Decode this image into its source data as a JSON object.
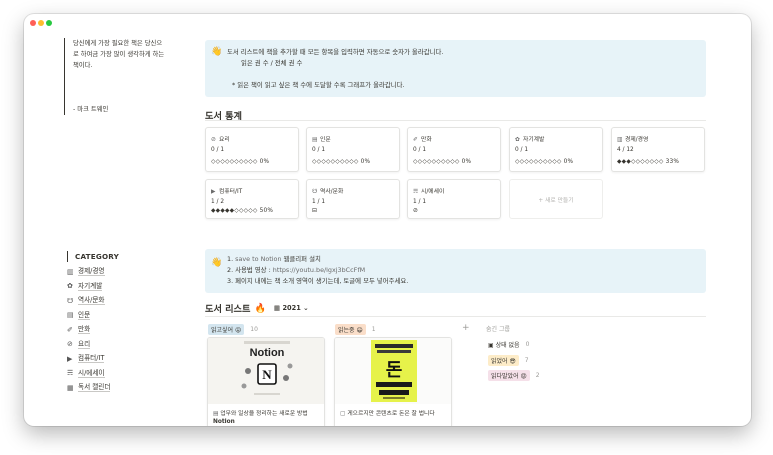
{
  "window": {
    "controls": [
      "close",
      "minimize",
      "zoom"
    ]
  },
  "quote": {
    "lines": [
      "당신에게 가장 필요한 책은 당신으",
      "로 하여금 가장 많이 생각하게 하는",
      "책이다."
    ],
    "author": "- 마크 트웨인"
  },
  "callout1": {
    "emoji": "👋",
    "line1": "도서 리스트에 책을 추가할 때 모든 항목을 입력하면 자동으로 숫자가 올라갑니다.",
    "line2": "읽은 권 수 / 전체 권 수",
    "line3": "* 읽은 책이 읽고 싶은 책 수에 도달할 수록 그래프가 올라갑니다."
  },
  "stats": {
    "title": "도서 통계",
    "cards": [
      {
        "icon": "⊘",
        "icon_name": "cooking-icon",
        "label": "요리",
        "count": "0 / 1",
        "bar": "◇◇◇◇◇◇◇◇◇◇ 0%",
        "fraction": 0.0
      },
      {
        "icon": "▤",
        "icon_name": "column-icon",
        "label": "인문",
        "count": "0 / 1",
        "bar": "◇◇◇◇◇◇◇◇◇◇ 0%",
        "fraction": 0.0
      },
      {
        "icon": "✐",
        "icon_name": "pen-icon",
        "label": "만화",
        "count": "0 / 1",
        "bar": "◇◇◇◇◇◇◇◇◇◇ 0%",
        "fraction": 0.0
      },
      {
        "icon": "✿",
        "icon_name": "brain-icon",
        "label": "자기계발",
        "count": "0 / 1",
        "bar": "◇◇◇◇◇◇◇◇◇◇ 0%",
        "fraction": 0.0
      },
      {
        "icon": "▥",
        "icon_name": "chart-icon",
        "label": "경제/경영",
        "count": "4 / 12",
        "bar": "◆◆◆◇◇◇◇◇◇◇ 33%",
        "fraction": 0.33
      },
      {
        "icon": "▶",
        "icon_name": "computer-icon",
        "label": "컴퓨터/IT",
        "count": "1 / 2",
        "bar": "◆◆◆◆◆◇◇◇◇◇ 50%",
        "fraction": 0.5
      },
      {
        "icon": "☋",
        "icon_name": "history-icon",
        "label": "역사/문화",
        "count": "1 / 1",
        "bar": "⊟",
        "fraction": 1.0
      },
      {
        "icon": "☴",
        "icon_name": "poetry-icon",
        "label": "시/에세이",
        "count": "1 / 1",
        "bar": "⊘",
        "fraction": 1.0
      }
    ],
    "new_label": "+ 새로 만들기"
  },
  "sidebar": {
    "heading": "CATEGORY",
    "items": [
      {
        "icon": "▥",
        "icon_name": "chart-icon",
        "label": "경제/경영"
      },
      {
        "icon": "✿",
        "icon_name": "brain-icon",
        "label": "자기계발"
      },
      {
        "icon": "☋",
        "icon_name": "history-icon",
        "label": "역사/문화"
      },
      {
        "icon": "▤",
        "icon_name": "column-icon",
        "label": "인문"
      },
      {
        "icon": "✐",
        "icon_name": "pen-icon",
        "label": "만화"
      },
      {
        "icon": "⊘",
        "icon_name": "cooking-icon",
        "label": "요리"
      },
      {
        "icon": "▶",
        "icon_name": "computer-icon",
        "label": "컴퓨터/IT"
      },
      {
        "icon": "☴",
        "icon_name": "poetry-icon",
        "label": "시/에세이"
      },
      {
        "icon": "▦",
        "icon_name": "calendar-icon",
        "label": "독서 캘린더"
      }
    ]
  },
  "callout2": {
    "emoji": "👋",
    "line1_pre": "1. ",
    "line1_link": "save to Notion",
    "line1_post": " 웹클리퍼 설치",
    "line2_pre": "2. 사용법 영상 : ",
    "line2_link": "https://youtu.be/lgxj3bCcFfM",
    "line3": "3. 페이지 내에는 책 소개 영역이 생기는데, 토글에 모두 넣어주세요."
  },
  "database": {
    "title": "도서 리스트",
    "title_emoji": "🔥",
    "view_icon": "▦",
    "view_label": "2021",
    "columns": [
      {
        "tag": "읽고싶어 😝",
        "count": "10",
        "card": {
          "icon": "▤",
          "cover_title": "Notion",
          "caption": "업무와 일상을 정리하는 새로운 방법",
          "caption2": "Notion"
        }
      },
      {
        "tag": "읽는중 😄",
        "count": "1",
        "card": {
          "icon": "▢",
          "cover_title": "돈",
          "caption": "게으르지만 콘텐츠로 돈은 잘 법니다",
          "caption2": ""
        }
      }
    ],
    "add_symbol": "+",
    "hidden_title": "숨긴 그룹",
    "hidden": [
      {
        "icon": "▣",
        "label": "상태 없음",
        "count": "0"
      },
      {
        "label": "읽었어 😎",
        "count": "7"
      },
      {
        "label": "읽다말았어 😡",
        "count": "2"
      }
    ]
  },
  "colors": {
    "callout_bg": "#e7f3f8",
    "close": "#ff5f57",
    "minimize": "#febc2e",
    "zoom": "#28c840",
    "tag_blue": "#d3e5ef",
    "tag_orange": "#fadec9",
    "tag_yellow": "#fdecc8",
    "tag_pink": "#f5e0e9"
  }
}
